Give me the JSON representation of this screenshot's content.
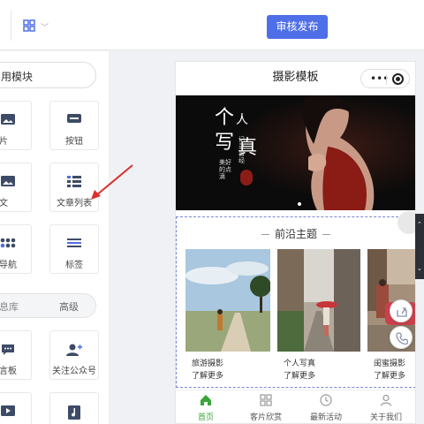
{
  "header": {
    "publish_label": "审核发布",
    "layout_icon": "grid-icon"
  },
  "sidebar": {
    "search_text": "用模块",
    "tiles": [
      {
        "label": "图片",
        "icon": "image-icon"
      },
      {
        "label": "按钮",
        "icon": "button-icon"
      },
      {
        "label": "图文",
        "icon": "image-text-icon"
      },
      {
        "label": "文章列表",
        "icon": "article-list-icon"
      },
      {
        "label": "方导航",
        "icon": "nav-grid-icon"
      },
      {
        "label": "标签",
        "icon": "tag-icon"
      },
      {
        "label": "留言板",
        "icon": "message-board-icon"
      },
      {
        "label": "关注公众号",
        "icon": "follow-icon"
      }
    ],
    "tabs": [
      "息库",
      "高级"
    ]
  },
  "preview": {
    "title": "摄影模板",
    "banner": {
      "title_chars": [
        "个",
        "人",
        "写",
        "真"
      ],
      "sub1": "记录曾经",
      "sub2": "美好的点滴"
    },
    "section_title": "前沿主题",
    "cards": [
      {
        "title": "旅游摄影",
        "more": "了解更多"
      },
      {
        "title": "个人写真",
        "more": "了解更多"
      },
      {
        "title": "闺蜜摄影",
        "more": "了解更多"
      }
    ],
    "tabbar": [
      {
        "label": "首页",
        "icon": "home-icon",
        "active": true
      },
      {
        "label": "客片欣赏",
        "icon": "gallery-icon",
        "active": false
      },
      {
        "label": "最新活动",
        "icon": "clock-icon",
        "active": false
      },
      {
        "label": "关于我们",
        "icon": "user-icon",
        "active": false
      }
    ]
  },
  "colors": {
    "primary": "#4f6fe8",
    "active_tab": "#3aa53a",
    "arrow": "#d9302a"
  }
}
